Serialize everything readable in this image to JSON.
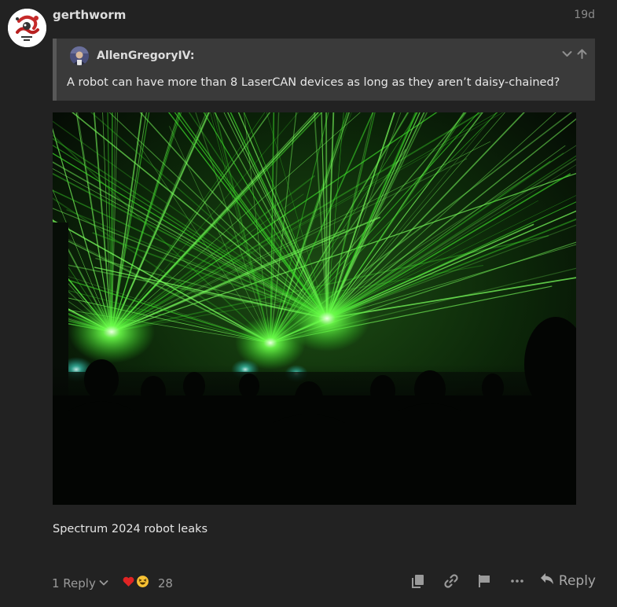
{
  "post": {
    "username": "gerthworm",
    "date": "19d",
    "caption": "Spectrum 2024 robot leaks"
  },
  "quote": {
    "username": "AllenGregoryIV:",
    "text": "A robot can have more than 8 LaserCAN devices as long as they aren’t daisy-chained?"
  },
  "footer": {
    "replies_label": "1 Reply",
    "reactions": [
      {
        "icon": "heart-emoji",
        "glyph": "❤️"
      },
      {
        "icon": "laughing-emoji",
        "glyph": "😆"
      }
    ],
    "reaction_count": "28",
    "actions": [
      "copy-icon",
      "link-icon",
      "flag-icon",
      "more-icon"
    ],
    "reply_label": "Reply"
  },
  "colors": {
    "background": "#222222",
    "quote_background": "#3a3a3a",
    "laser_green": "#2fd21f"
  }
}
